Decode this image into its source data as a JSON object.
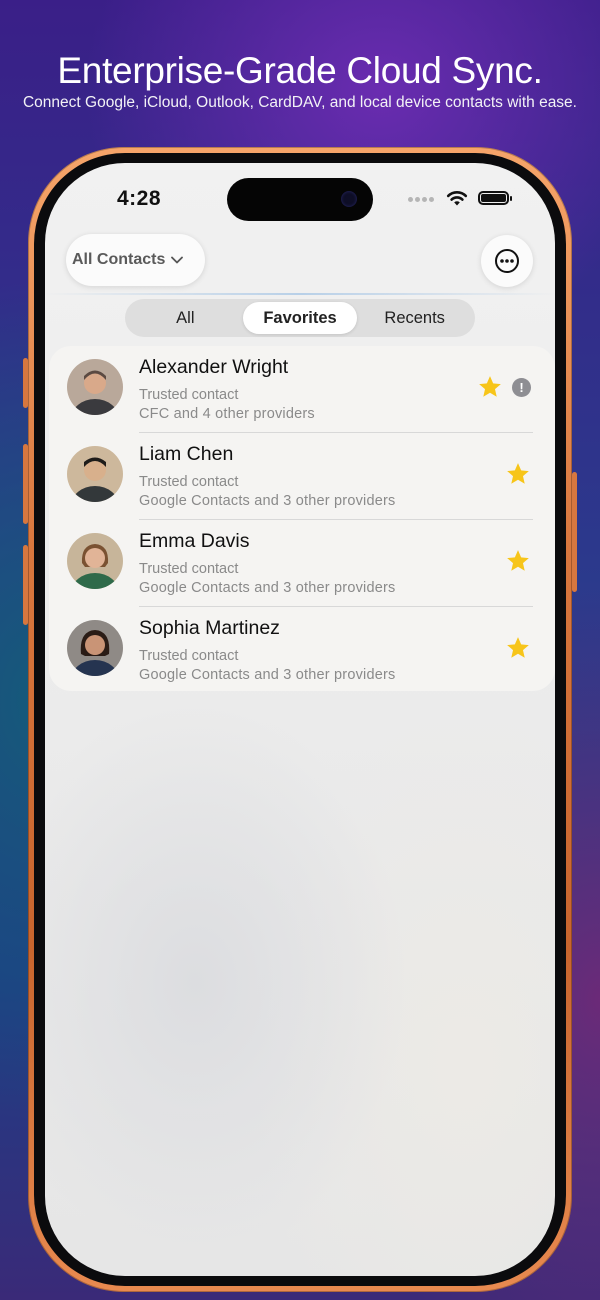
{
  "promo": {
    "headline": "Enterprise-Grade Cloud Sync.",
    "subline": "Connect Google, iCloud, Outlook, CardDAV, and local device contacts with ease."
  },
  "status_bar": {
    "time": "4:28",
    "icons": [
      "signal-dots-icon",
      "wifi-icon",
      "battery-icon"
    ]
  },
  "header": {
    "filter_label": "All Contacts",
    "more_icon": "ellipsis-circle-icon"
  },
  "tabs": [
    {
      "label": "All",
      "active": false
    },
    {
      "label": "Favorites",
      "active": true
    },
    {
      "label": "Recents",
      "active": false
    }
  ],
  "contacts": [
    {
      "name": "Alexander Wright",
      "status": "Trusted contact",
      "providers": "CFC and 4 other providers",
      "favorite": true,
      "has_info": true,
      "info_glyph": "!",
      "avatar_color": "#5b4a42"
    },
    {
      "name": "Liam Chen",
      "status": "Trusted contact",
      "providers": "Google Contacts and 3 other providers",
      "favorite": true,
      "has_info": false,
      "avatar_color": "#3e3a36"
    },
    {
      "name": "Emma Davis",
      "status": "Trusted contact",
      "providers": "Google Contacts and 3 other providers",
      "favorite": true,
      "has_info": false,
      "avatar_color": "#2f6a4a"
    },
    {
      "name": "Sophia Martinez",
      "status": "Trusted contact",
      "providers": "Google Contacts and 3 other providers",
      "favorite": true,
      "has_info": false,
      "avatar_color": "#253450"
    }
  ],
  "colors": {
    "star": "#f7c51a",
    "info": "#8e8e93",
    "frame": "#d9773e"
  }
}
